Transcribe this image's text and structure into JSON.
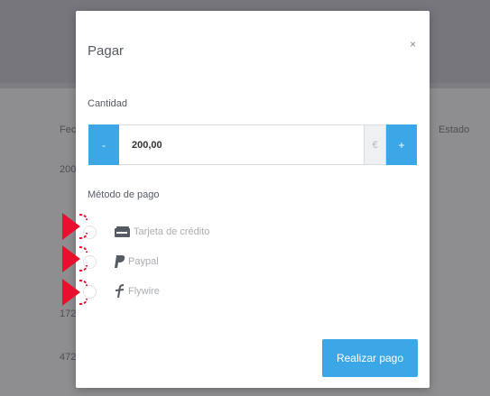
{
  "background": {
    "rows": [
      "Fec",
      "200",
      "172",
      "472"
    ],
    "right_header": "Estado"
  },
  "modal": {
    "title": "Pagar",
    "close_icon": "close-icon",
    "quantity": {
      "label": "Cantidad",
      "minus_label": "-",
      "plus_label": "+",
      "value": "200,00",
      "currency": "€"
    },
    "payment_method": {
      "label": "Método de pago",
      "options": [
        {
          "label": "Tarjeta de crédito",
          "icon": "credit-card-icon"
        },
        {
          "label": "Paypal",
          "icon": "paypal-icon"
        },
        {
          "label": "Flywire",
          "icon": "flywire-icon"
        }
      ]
    },
    "submit_label": "Realizar pago"
  },
  "colors": {
    "accent": "#3ba7e6",
    "overlay": "#8e8e91",
    "annotation": "#e8102e"
  }
}
